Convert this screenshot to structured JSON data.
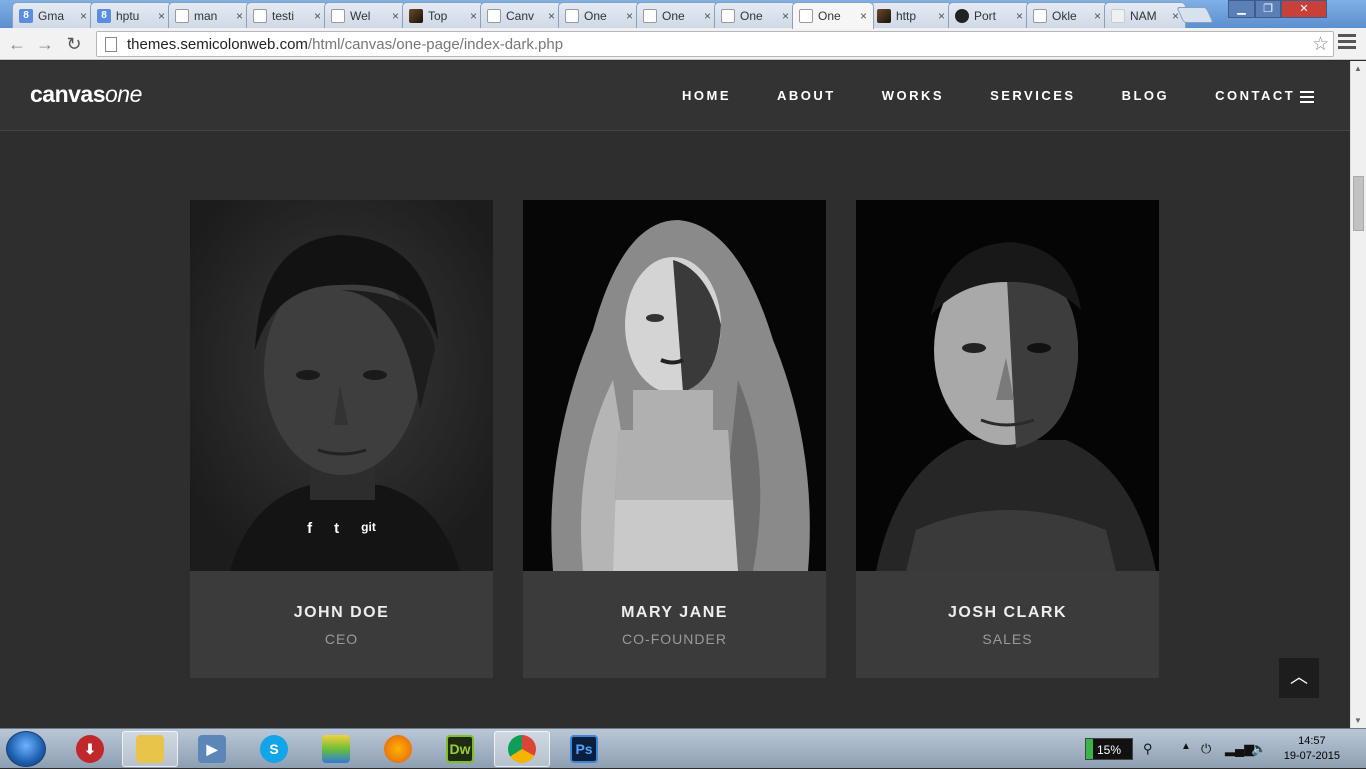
{
  "browser": {
    "tabs": [
      {
        "title": "Gma",
        "favicon": "google-icon"
      },
      {
        "title": "hptu",
        "favicon": "google-icon"
      },
      {
        "title": "man",
        "favicon": "page-icon"
      },
      {
        "title": "testi",
        "favicon": "page-icon"
      },
      {
        "title": "Wel",
        "favicon": "page-icon"
      },
      {
        "title": "Top",
        "favicon": "image-icon"
      },
      {
        "title": "Canv",
        "favicon": "page-icon"
      },
      {
        "title": "One",
        "favicon": "page-icon"
      },
      {
        "title": "One",
        "favicon": "page-icon"
      },
      {
        "title": "One",
        "favicon": "page-icon"
      },
      {
        "title": "One",
        "favicon": "page-icon",
        "active": true
      },
      {
        "title": "http",
        "favicon": "image-icon"
      },
      {
        "title": "Port",
        "favicon": "github-icon"
      },
      {
        "title": "Okle",
        "favicon": "page-icon"
      },
      {
        "title": "NAM",
        "favicon": "blank-icon"
      }
    ],
    "url_host": "themes.semicolonweb.com",
    "url_path": "/html/canvas/one-page/index-dark.php"
  },
  "site": {
    "logo_bold": "canvas",
    "logo_italic": "one",
    "nav": [
      "HOME",
      "ABOUT",
      "WORKS",
      "SERVICES",
      "BLOG",
      "CONTACT"
    ]
  },
  "team": [
    {
      "name": "JOHN DOE",
      "role": "CEO",
      "socials": [
        "f",
        "t",
        "git"
      ]
    },
    {
      "name": "MARY JANE",
      "role": "CO-FOUNDER"
    },
    {
      "name": "JOSH CLARK",
      "role": "SALES"
    }
  ],
  "taskbar": {
    "apps": [
      "chrome-downloader-icon",
      "file-explorer-icon",
      "video-icon",
      "skype-icon",
      "bluestacks-icon",
      "firefox-icon",
      "dreamweaver-icon",
      "chrome-icon",
      "photoshop-icon"
    ],
    "dw_label": "Dw",
    "ps_label": "Ps",
    "battery": "15%",
    "time": "14:57",
    "date": "19-07-2015"
  }
}
